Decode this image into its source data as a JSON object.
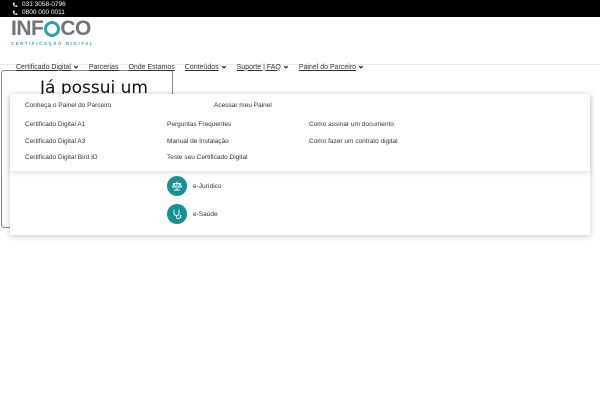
{
  "topbar": {
    "phones": [
      "031 3058-0796",
      "0800 000 0011"
    ]
  },
  "logo": {
    "word_left": "INF",
    "word_right": "CO",
    "tagline": "CERTIFICAÇÃO DIGITAL"
  },
  "nav": {
    "items": [
      {
        "label": "Certificado Digital",
        "has_dropdown": true
      },
      {
        "label": "Parcerias",
        "has_dropdown": false
      },
      {
        "label": "Onde Estamos",
        "has_dropdown": false
      },
      {
        "label": "Conteúdos",
        "has_dropdown": true
      },
      {
        "label": "Suporte | FAQ",
        "has_dropdown": true
      },
      {
        "label": "Painel do Parceiro",
        "has_dropdown": true
      }
    ]
  },
  "background": {
    "heading": "Já possui um"
  },
  "dropdown": {
    "top_links": [
      "Conheça o Painel do Parceiro",
      "Acessar meu Painel"
    ],
    "col1": [
      "Certificado Digital A1",
      "Certificado Digital A3",
      "Certificado Digital Bird ID"
    ],
    "col2": [
      "Perguntas Frequentes",
      "Manual de Instalação",
      "Teste seu Certificado Digital"
    ],
    "col3": [
      "Como assinar um documento",
      "Como fazer um contrato digital"
    ],
    "sectors": [
      {
        "label": "e-Jurídico",
        "icon": "scales-icon"
      },
      {
        "label": "e-Saúde",
        "icon": "stethoscope-icon"
      }
    ]
  },
  "colors": {
    "brand_teal": "#2aa3a6",
    "icon_teal": "#168f95",
    "topbar": "#000000"
  }
}
